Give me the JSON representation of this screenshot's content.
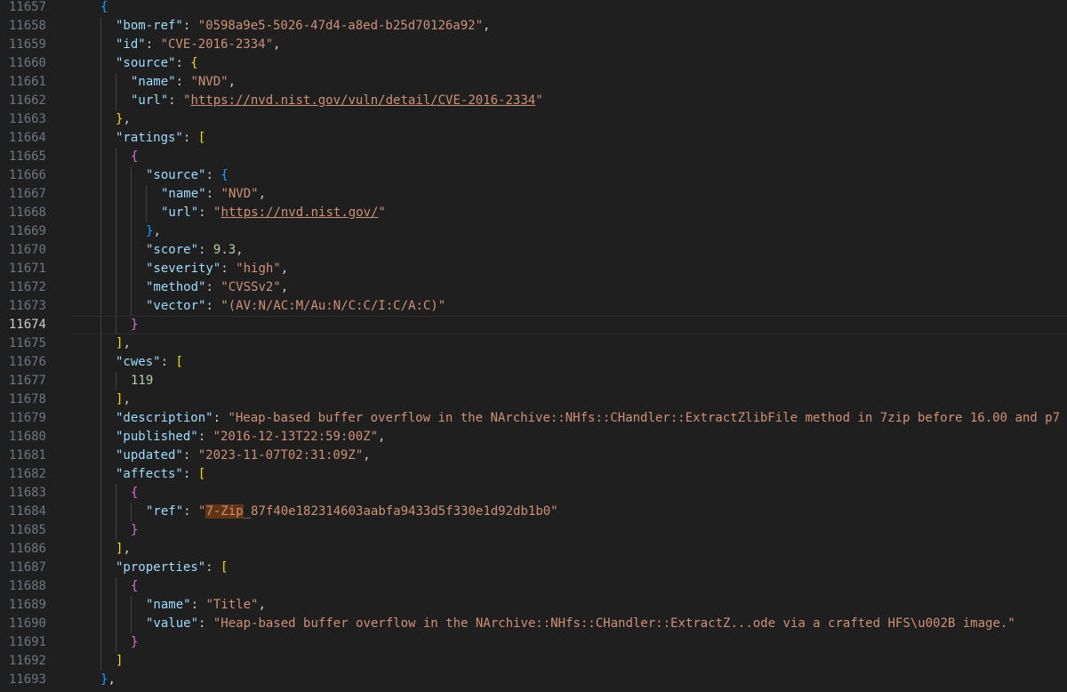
{
  "editor": {
    "language": "json",
    "active_line": 11674,
    "colors": {
      "background": "#1f1f1f",
      "line_number": "#6e7681",
      "active_line_number": "#cccccc",
      "key": "#9cdcfe",
      "string": "#ce9178",
      "number": "#b5cea8",
      "punctuation": "#cccccc",
      "bracket_gold": "#ffd700",
      "bracket_orchid": "#da70d6",
      "bracket_blue": "#179fff",
      "find_highlight": "#623315"
    },
    "lines": [
      {
        "num": "11657",
        "indent": 1,
        "tokens": [
          [
            "{",
            "b2"
          ]
        ]
      },
      {
        "num": "11658",
        "indent": 2,
        "tokens": [
          [
            "\"bom-ref\"",
            "k"
          ],
          [
            ": ",
            "p"
          ],
          [
            "\"0598a9e5-5026-47d4-a8ed-b25d70126a92\"",
            "s"
          ],
          [
            ",",
            "p"
          ]
        ]
      },
      {
        "num": "11659",
        "indent": 2,
        "tokens": [
          [
            "\"id\"",
            "k"
          ],
          [
            ": ",
            "p"
          ],
          [
            "\"CVE-2016-2334\"",
            "s"
          ],
          [
            ",",
            "p"
          ]
        ]
      },
      {
        "num": "11660",
        "indent": 2,
        "tokens": [
          [
            "\"source\"",
            "k"
          ],
          [
            ": ",
            "p"
          ],
          [
            "{",
            "b0"
          ]
        ]
      },
      {
        "num": "11661",
        "indent": 3,
        "tokens": [
          [
            "\"name\"",
            "k"
          ],
          [
            ": ",
            "p"
          ],
          [
            "\"NVD\"",
            "s"
          ],
          [
            ",",
            "p"
          ]
        ]
      },
      {
        "num": "11662",
        "indent": 3,
        "tokens": [
          [
            "\"url\"",
            "k"
          ],
          [
            ": ",
            "p"
          ],
          [
            "\"",
            "s"
          ],
          [
            "https://nvd.nist.gov/vuln/detail/CVE-2016-2334",
            "s u"
          ],
          [
            "\"",
            "s"
          ]
        ]
      },
      {
        "num": "11663",
        "indent": 2,
        "tokens": [
          [
            "}",
            "b0"
          ],
          [
            ",",
            "p"
          ]
        ]
      },
      {
        "num": "11664",
        "indent": 2,
        "tokens": [
          [
            "\"ratings\"",
            "k"
          ],
          [
            ": ",
            "p"
          ],
          [
            "[",
            "b0"
          ]
        ]
      },
      {
        "num": "11665",
        "indent": 3,
        "tokens": [
          [
            "{",
            "b1"
          ]
        ]
      },
      {
        "num": "11666",
        "indent": 4,
        "tokens": [
          [
            "\"source\"",
            "k"
          ],
          [
            ": ",
            "p"
          ],
          [
            "{",
            "b2"
          ]
        ]
      },
      {
        "num": "11667",
        "indent": 5,
        "tokens": [
          [
            "\"name\"",
            "k"
          ],
          [
            ": ",
            "p"
          ],
          [
            "\"NVD\"",
            "s"
          ],
          [
            ",",
            "p"
          ]
        ]
      },
      {
        "num": "11668",
        "indent": 5,
        "tokens": [
          [
            "\"url\"",
            "k"
          ],
          [
            ": ",
            "p"
          ],
          [
            "\"",
            "s"
          ],
          [
            "https://nvd.nist.gov/",
            "s u"
          ],
          [
            "\"",
            "s"
          ]
        ]
      },
      {
        "num": "11669",
        "indent": 4,
        "tokens": [
          [
            "}",
            "b2"
          ],
          [
            ",",
            "p"
          ]
        ]
      },
      {
        "num": "11670",
        "indent": 4,
        "tokens": [
          [
            "\"score\"",
            "k"
          ],
          [
            ": ",
            "p"
          ],
          [
            "9.3",
            "n"
          ],
          [
            ",",
            "p"
          ]
        ]
      },
      {
        "num": "11671",
        "indent": 4,
        "tokens": [
          [
            "\"severity\"",
            "k"
          ],
          [
            ": ",
            "p"
          ],
          [
            "\"high\"",
            "s"
          ],
          [
            ",",
            "p"
          ]
        ]
      },
      {
        "num": "11672",
        "indent": 4,
        "tokens": [
          [
            "\"method\"",
            "k"
          ],
          [
            ": ",
            "p"
          ],
          [
            "\"CVSSv2\"",
            "s"
          ],
          [
            ",",
            "p"
          ]
        ]
      },
      {
        "num": "11673",
        "indent": 4,
        "tokens": [
          [
            "\"vector\"",
            "k"
          ],
          [
            ": ",
            "p"
          ],
          [
            "\"(AV:N/AC:M/Au:N/C:C/I:C/A:C)\"",
            "s"
          ]
        ]
      },
      {
        "num": "11674",
        "indent": 3,
        "tokens": [
          [
            "}",
            "b1"
          ]
        ]
      },
      {
        "num": "11675",
        "indent": 2,
        "tokens": [
          [
            "]",
            "b0"
          ],
          [
            ",",
            "p"
          ]
        ]
      },
      {
        "num": "11676",
        "indent": 2,
        "tokens": [
          [
            "\"cwes\"",
            "k"
          ],
          [
            ": ",
            "p"
          ],
          [
            "[",
            "b0"
          ]
        ]
      },
      {
        "num": "11677",
        "indent": 3,
        "tokens": [
          [
            "119",
            "n"
          ]
        ]
      },
      {
        "num": "11678",
        "indent": 2,
        "tokens": [
          [
            "]",
            "b0"
          ],
          [
            ",",
            "p"
          ]
        ]
      },
      {
        "num": "11679",
        "indent": 2,
        "tokens": [
          [
            "\"description\"",
            "k"
          ],
          [
            ": ",
            "p"
          ],
          [
            "\"Heap-based buffer overflow in the NArchive::NHfs::CHandler::ExtractZlibFile method in 7zip before 16.00 and p7",
            "s"
          ]
        ]
      },
      {
        "num": "11680",
        "indent": 2,
        "tokens": [
          [
            "\"published\"",
            "k"
          ],
          [
            ": ",
            "p"
          ],
          [
            "\"2016-12-13T22:59:00Z\"",
            "s"
          ],
          [
            ",",
            "p"
          ]
        ]
      },
      {
        "num": "11681",
        "indent": 2,
        "tokens": [
          [
            "\"updated\"",
            "k"
          ],
          [
            ": ",
            "p"
          ],
          [
            "\"2023-11-07T02:31:09Z\"",
            "s"
          ],
          [
            ",",
            "p"
          ]
        ]
      },
      {
        "num": "11682",
        "indent": 2,
        "tokens": [
          [
            "\"affects\"",
            "k"
          ],
          [
            ": ",
            "p"
          ],
          [
            "[",
            "b0"
          ]
        ]
      },
      {
        "num": "11683",
        "indent": 3,
        "tokens": [
          [
            "{",
            "b1"
          ]
        ]
      },
      {
        "num": "11684",
        "indent": 4,
        "tokens": [
          [
            "\"ref\"",
            "k"
          ],
          [
            ": ",
            "p"
          ],
          [
            "\"",
            "s"
          ],
          [
            "7-Zip",
            "s hl"
          ],
          [
            "_87f40e182314603aabfa9433d5f330e1d92db1b0\"",
            "s"
          ]
        ]
      },
      {
        "num": "11685",
        "indent": 3,
        "tokens": [
          [
            "}",
            "b1"
          ]
        ]
      },
      {
        "num": "11686",
        "indent": 2,
        "tokens": [
          [
            "]",
            "b0"
          ],
          [
            ",",
            "p"
          ]
        ]
      },
      {
        "num": "11687",
        "indent": 2,
        "tokens": [
          [
            "\"properties\"",
            "k"
          ],
          [
            ": ",
            "p"
          ],
          [
            "[",
            "b0"
          ]
        ]
      },
      {
        "num": "11688",
        "indent": 3,
        "tokens": [
          [
            "{",
            "b1"
          ]
        ]
      },
      {
        "num": "11689",
        "indent": 4,
        "tokens": [
          [
            "\"name\"",
            "k"
          ],
          [
            ": ",
            "p"
          ],
          [
            "\"Title\"",
            "s"
          ],
          [
            ",",
            "p"
          ]
        ]
      },
      {
        "num": "11690",
        "indent": 4,
        "tokens": [
          [
            "\"value\"",
            "k"
          ],
          [
            ": ",
            "p"
          ],
          [
            "\"Heap-based buffer overflow in the NArchive::NHfs::CHandler::ExtractZ...ode via a crafted HFS\\u002B image.\"",
            "s"
          ]
        ]
      },
      {
        "num": "11691",
        "indent": 3,
        "tokens": [
          [
            "}",
            "b1"
          ]
        ]
      },
      {
        "num": "11692",
        "indent": 2,
        "tokens": [
          [
            "]",
            "b0"
          ]
        ]
      },
      {
        "num": "11693",
        "indent": 1,
        "tokens": [
          [
            "}",
            "b2"
          ],
          [
            ",",
            "p"
          ]
        ]
      }
    ]
  }
}
